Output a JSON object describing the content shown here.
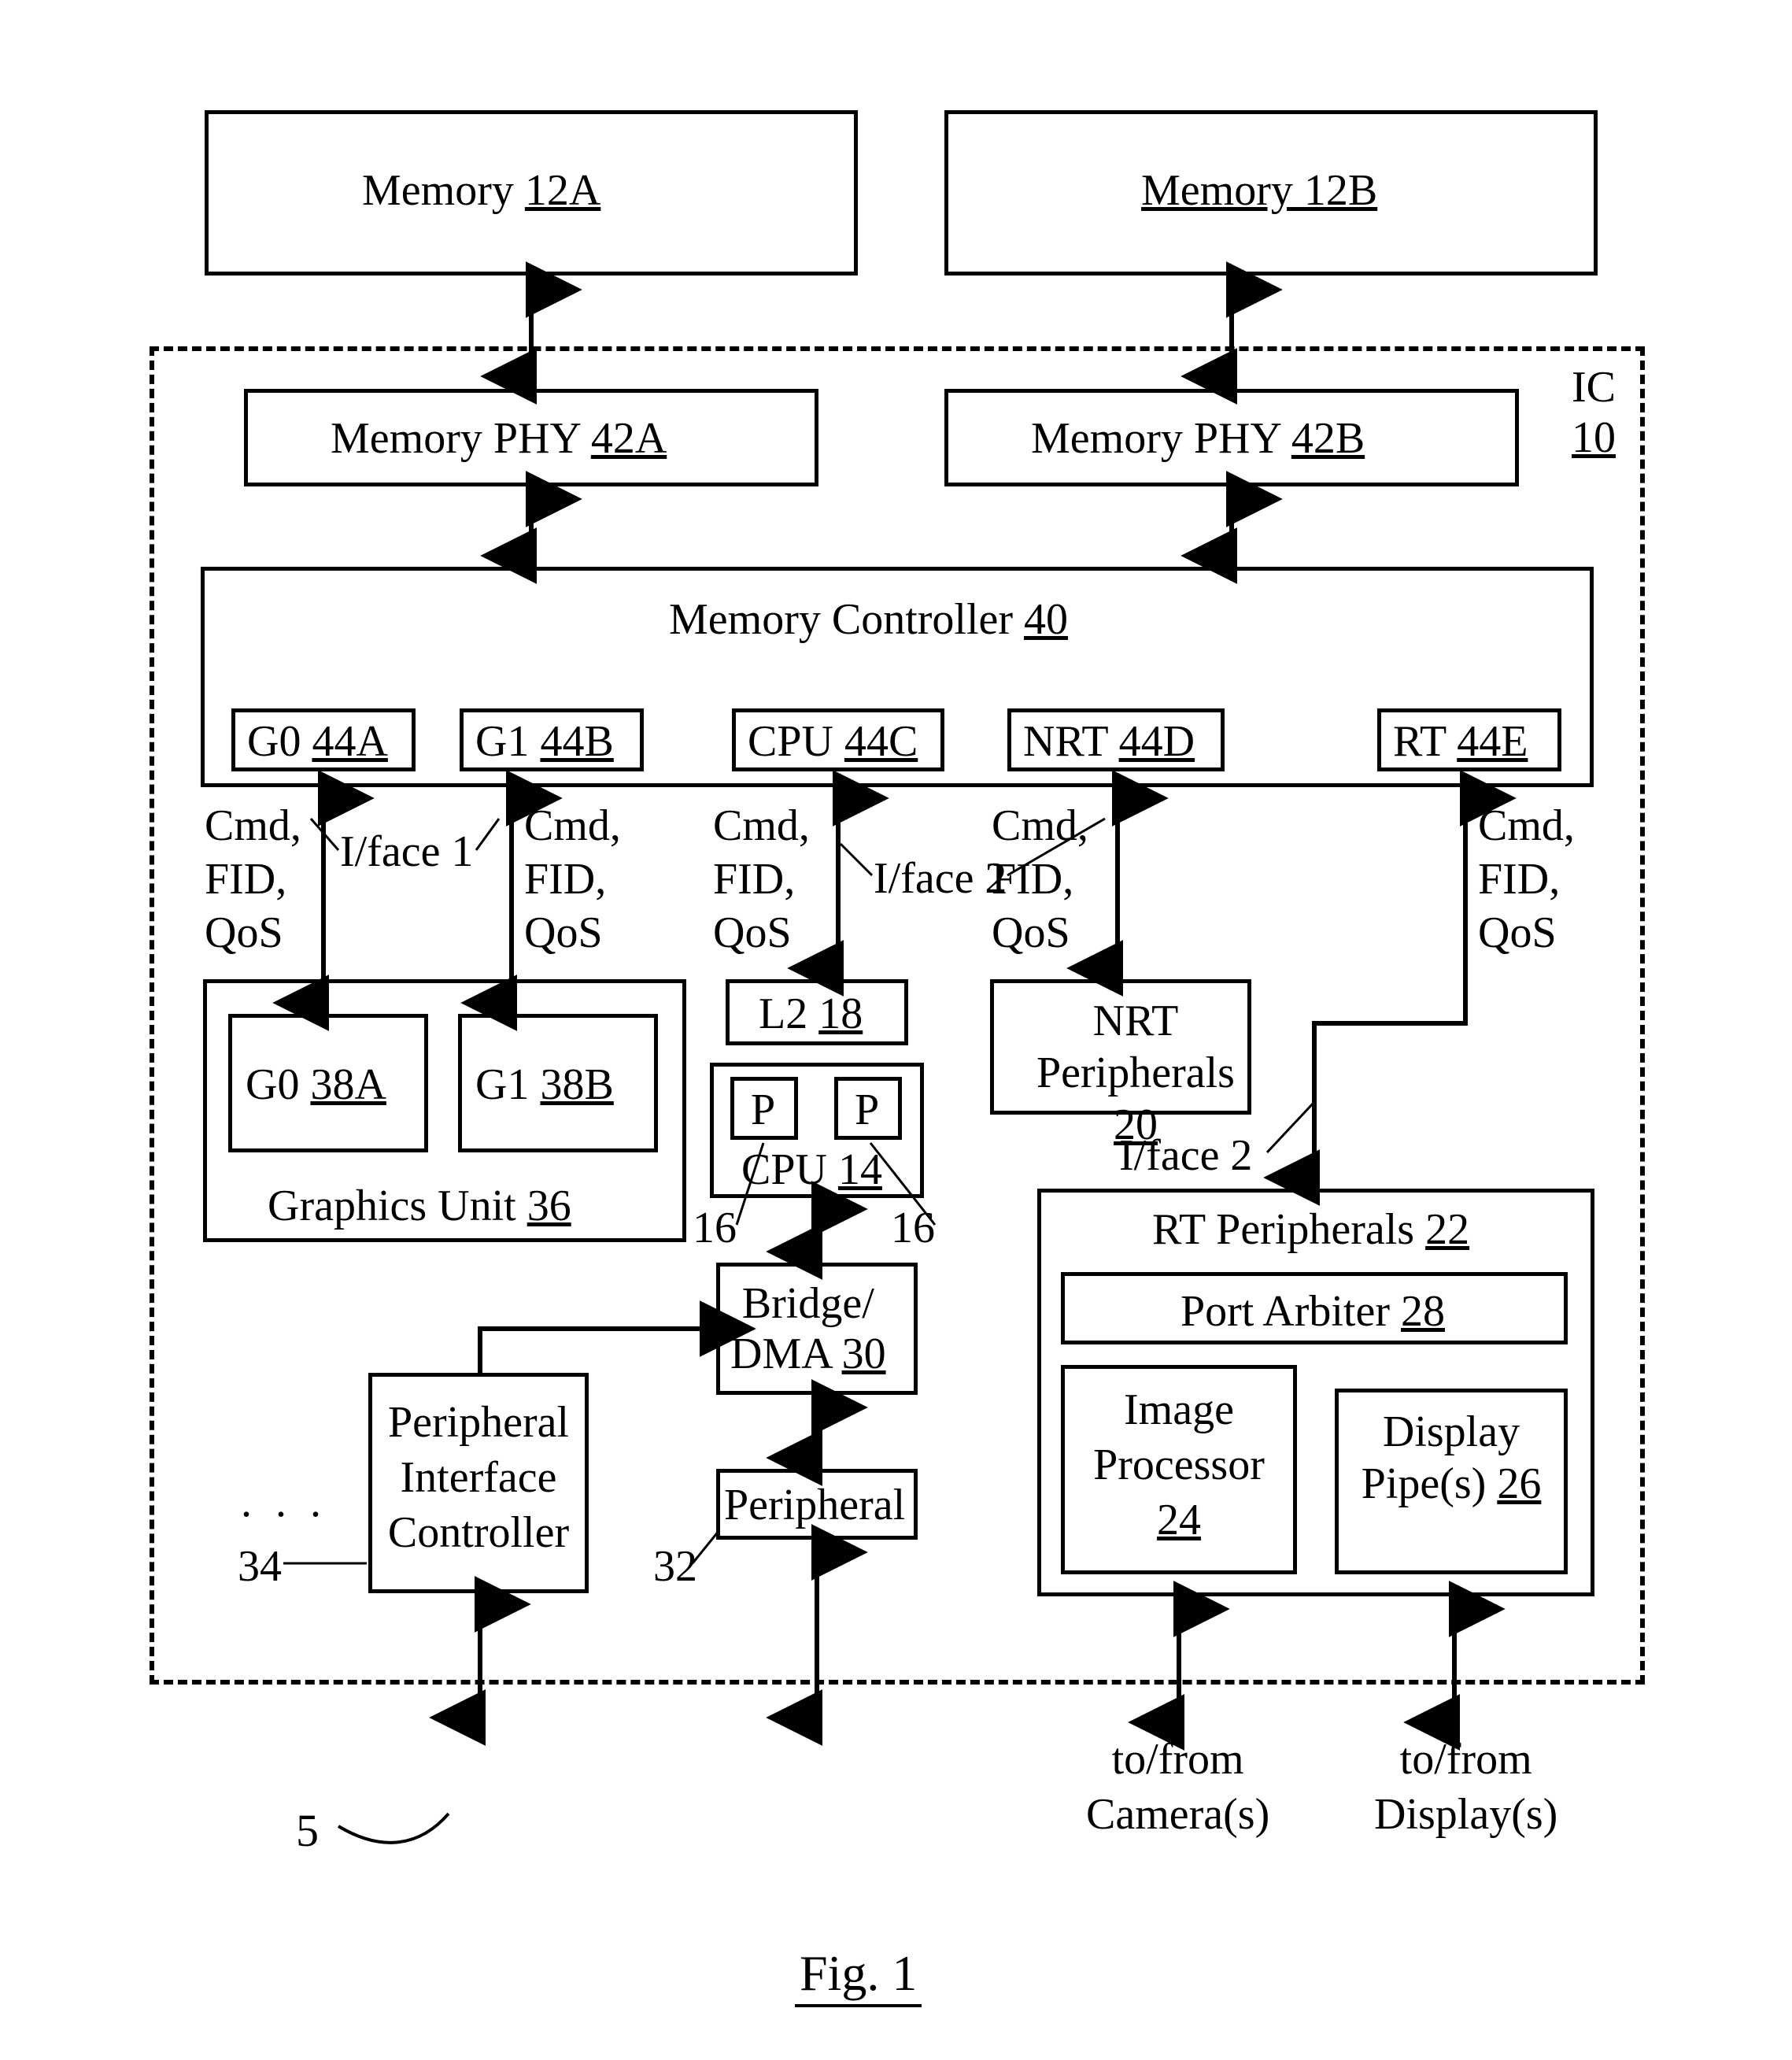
{
  "figure": {
    "caption": "Fig. 1",
    "ref": "5"
  },
  "ic": {
    "label": "IC",
    "ref": "10"
  },
  "memory": {
    "a": "Memory",
    "a_ref": "12A",
    "b": "Memory 12B"
  },
  "phy": {
    "a": "Memory PHY",
    "a_ref": "42A",
    "b": "Memory PHY",
    "b_ref": "42B"
  },
  "memctl": {
    "label": "Memory Controller",
    "ref": "40"
  },
  "ports": {
    "g0": "G0",
    "g0_ref": "44A",
    "g1": "G1",
    "g1_ref": "44B",
    "cpu": "CPU",
    "cpu_ref": "44C",
    "nrt": "NRT",
    "nrt_ref": "44D",
    "rt": "RT",
    "rt_ref": "44E"
  },
  "signals": {
    "l1": "Cmd,",
    "l2": "FID,",
    "l3": "QoS",
    "iface1": "I/face 1",
    "iface2": "I/face 2"
  },
  "gfx": {
    "unit": "Graphics Unit",
    "unit_ref": "36",
    "g0": "G0",
    "g0_ref": "38A",
    "g1": "G1",
    "g1_ref": "38B"
  },
  "cpu": {
    "l2": "L2",
    "l2_ref": "18",
    "p": "P",
    "label": "CPU",
    "ref": "14",
    "core_ref": "16"
  },
  "nrt": {
    "label_l1": "NRT",
    "label_l2": "Peripherals",
    "ref": "20"
  },
  "rt": {
    "label": "RT Peripherals",
    "ref": "22",
    "arbiter": "Port Arbiter",
    "arbiter_ref": "28",
    "img_l1": "Image",
    "img_l2": "Processor",
    "img_ref": "24",
    "disp_l1": "Display",
    "disp_l2": "Pipe(s)",
    "disp_ref": "26"
  },
  "bridge": {
    "l1": "Bridge/",
    "l2": "DMA",
    "ref": "30"
  },
  "peripheral": {
    "label": "Peripheral",
    "ref": "32"
  },
  "pic": {
    "l1": "Peripheral",
    "l2": "Interface",
    "l3": "Controller",
    "ref": "34"
  },
  "io": {
    "cam_l1": "to/from",
    "cam_l2": "Camera(s)",
    "disp_l1": "to/from",
    "disp_l2": "Display(s)"
  },
  "dots": ". . ."
}
